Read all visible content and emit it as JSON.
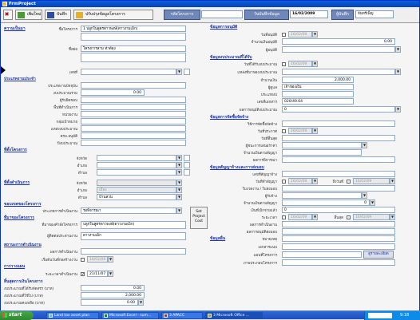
{
  "window": {
    "title": "FrmProject"
  },
  "toolbar": {
    "btn_new": "เพิ่มใหม่",
    "btn_save": "บันทึก",
    "btn_find": "ปรับปรุงข้อมูลโครงการ",
    "label_project_code": "รหัสโครงการ",
    "project_code_value": "",
    "label_record_date": "วันบันทึกข้อมูล",
    "record_date_value": "16/02/2009",
    "label_recorder": "ผู้บันทึก",
    "recorder_value": "จันทร์เพ็ญ"
  },
  "left": {
    "sec_project": "ความเป็นมา",
    "lbl_project_name": "ชื่อโครงการ",
    "project_name_value": "1 ปลูกในสูตรดาวพงษ์(ดาวงามเม็ก)",
    "lbl_short_name": "ชื่อย่อ",
    "short_name_value": "โครงการสาม ท่าด้อง",
    "lbl_number": "เลขที่",
    "sec_type": "ประเภทงานประจำ",
    "lbl_type": "ประเภทงานปัจจุบัน",
    "lbl_budget": "งบประมาณรวม",
    "budget_value": "0.00",
    "lbl_owner": "ผู้รับผิดชอบ",
    "lbl_area": "พื้นที่ดำเนินการ",
    "lbl_dept": "หน่วยงาน",
    "lbl_target": "กลุ่มเป้าหมาย",
    "lbl_source": "แหล่งงบประมาณ",
    "lbl_cabinet": "ครม.อนุมัติ",
    "lbl_year": "ปีงบประมาณ",
    "sec_location": "ที่ตั้งโครงการ",
    "lbl_province": "จังหวัด",
    "lbl_district": "อำเภอ",
    "lbl_subdistrict": "ตำบล",
    "sec_location2": "ที่ตั้งดำเนินการ",
    "lbl_province2": "จังหวัด",
    "lbl_district2": "อำเภอ",
    "lbl_subdistrict2": "ตำบล",
    "subdistrict2_value": "บ้านสวน",
    "district2_value": "เมือง",
    "province2_value": "",
    "sec_contract": "ขอบเขตของโครงการ",
    "lbl_contract_type": "ประเภทการดำเนินงาน",
    "contract_type_value": "รอพิจารณา",
    "sec_agency": "ที่มาของโครงการ",
    "lbl_agency": "ที่มาของคำสั่งโครงการ",
    "agency_value": "ปลูกในสูตรดาวพงษ์(ดาวงามเม็ก)",
    "lbl_contact": "ผู้ติดต่อประสานงาน",
    "contact_value": "ดาวงามเม็ก",
    "sec_status": "สถานะการดำเนินงาน",
    "lbl_status": "ผลการดำเนินงาน",
    "lbl_start": "เริ่มต้นวันที่ก่อสร้างงาน",
    "start_date": "16/02/09",
    "sec_plan": "การวางแผน",
    "lbl_plan_date": "ระยะเวลาดำเนินงาน",
    "plan_date": "21/11/07",
    "sec_finance": "สิ้นสุดการเงินโครงการ",
    "lbl_fin1": "งบประมาณที่ได้รับจัดสรร (บาท)",
    "fin1_value": "0.00",
    "lbl_fin2": "งบประมาณที่ใช้ไป (บาท)",
    "fin2_value": "2,000.00",
    "lbl_fin3": "งบประมาณคงเหลือ (บาท)",
    "fin3_value": "0.00"
  },
  "right": {
    "sec_approval": "ข้อมูลการอนุมัติ",
    "lbl_approve_date": "วันที่อนุมัติ",
    "approve_date": "16/02/09",
    "lbl_approve_amount": "จำนวนเงินอนุมัติ",
    "approve_amount": "0.00",
    "lbl_approve_by": "ผู้อนุมัติ",
    "sec_budget": "ข้อมูลงบประมาณที่ได้รับ",
    "lbl_budget_date": "วันที่ได้รับงบประมาณ",
    "budget_date": "16/02/09",
    "lbl_budget_source": "แหล่งที่มาของงบประมาณ",
    "lbl_budget_amount": "จำนวนเงิน",
    "budget_amount": "2,000.00",
    "lbl_budget_owner": "ผู้ดูแล",
    "budget_owner": "เจ้าของเงิน",
    "lbl_budget_type": "ประเภทงบ",
    "lbl_budget_code": "เลขที่เอกสาร",
    "budget_code": "020/49.64",
    "lbl_budget_approve": "ผลการอนุมัติงบประมาณ",
    "budget_approve": "0",
    "sec_procure": "ข้อมูลการจัดซื้อจัดจ้าง",
    "lbl_proc_method": "วิธีการจัดซื้อจัดจ้าง",
    "lbl_proc_date": "วันที่ประกาศ",
    "proc_date": "16/02/09",
    "lbl_proc_end": "วันที่สิ้นสุด",
    "lbl_proc_winner": "ผู้ชนะการเสนอราคา",
    "lbl_proc_amount": "จำนวนเงินตามสัญญา",
    "lbl_proc_sign": "ผลการพิจารณา",
    "sec_contract": "ข้อมูลสัญญาจ้างและการส่งมอบ",
    "lbl_contract_no": "เลขที่สัญญาจ้าง",
    "lbl_contract_date": "วันที่ทำสัญญา",
    "contract_date": "16/02/09",
    "lbl_contract_to": "ถึงวันที่",
    "contract_to": "16/02/09",
    "lbl_contract_sign": "ใบงวดงาน / ใบส่งมอบ",
    "lbl_contractor": "ผู้รับจ้าง",
    "lbl_contract_total": "จำนวนเงินตามสัญญา",
    "contract_total": "0",
    "lbl_contract_paid": "เงินที่เบิกจ่ายแล้ว",
    "contract_paid": "0",
    "lbl_period": "ระยะเวลา",
    "period_from": "16/02/09",
    "lbl_period_to": "สิ้นสุด",
    "period_to": "16/02/09",
    "lbl_result": "ผลการดำเนินงาน",
    "lbl_result2": "ผลการอนุมัติส่งมอบ",
    "sec_other": "ข้อมูลอื่น",
    "lbl_note": "หมายเหตุ",
    "lbl_attach": "เอกสารแนบ",
    "lbl_map": "แผนที่โครงการ",
    "lbl_image": "ภาพประกอบโครงการ",
    "btn_view": "ดูรายละเอียด"
  },
  "popup": {
    "line1": "Set",
    "line2": "Project",
    "line3": "Cost"
  },
  "taskbar": {
    "start": "start",
    "t1": "Land tax asset plan",
    "t2": "Microsoft Excel - sum...",
    "t3": "3 APACC",
    "t4": "3 Microsoft Office ...",
    "clock": "9:18"
  }
}
